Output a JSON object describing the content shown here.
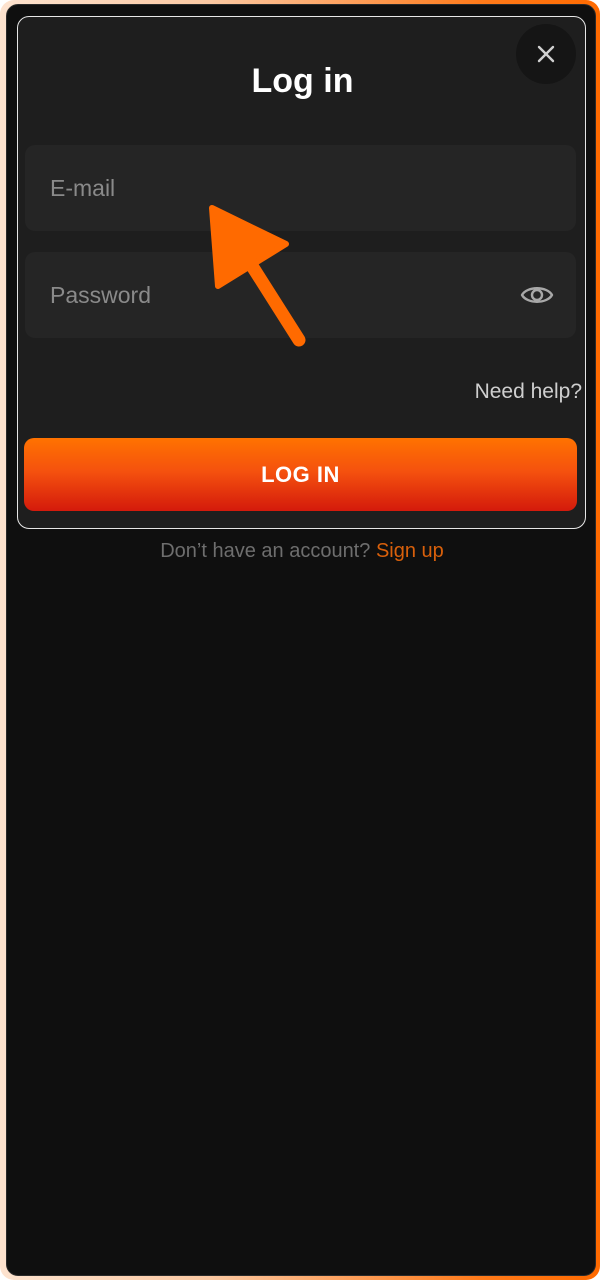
{
  "modal": {
    "title": "Log in",
    "close_icon": "close-icon",
    "email_placeholder": "E-mail",
    "email_value": "",
    "password_placeholder": "Password",
    "password_value": "",
    "eye_icon": "eye-icon",
    "need_help": "Need help?",
    "login_label": "LOG IN"
  },
  "signup": {
    "prompt": "Don’t have an account?",
    "link": "Sign up"
  },
  "colors": {
    "accent": "#ff6a00",
    "button_top": "#ff7300",
    "button_bottom": "#d41a0c",
    "signup_link": "#d9600b",
    "background": "#0f0f0f"
  },
  "annotation": {
    "arrow_icon": "arrow-icon",
    "arrow_color": "#ff6a00"
  }
}
